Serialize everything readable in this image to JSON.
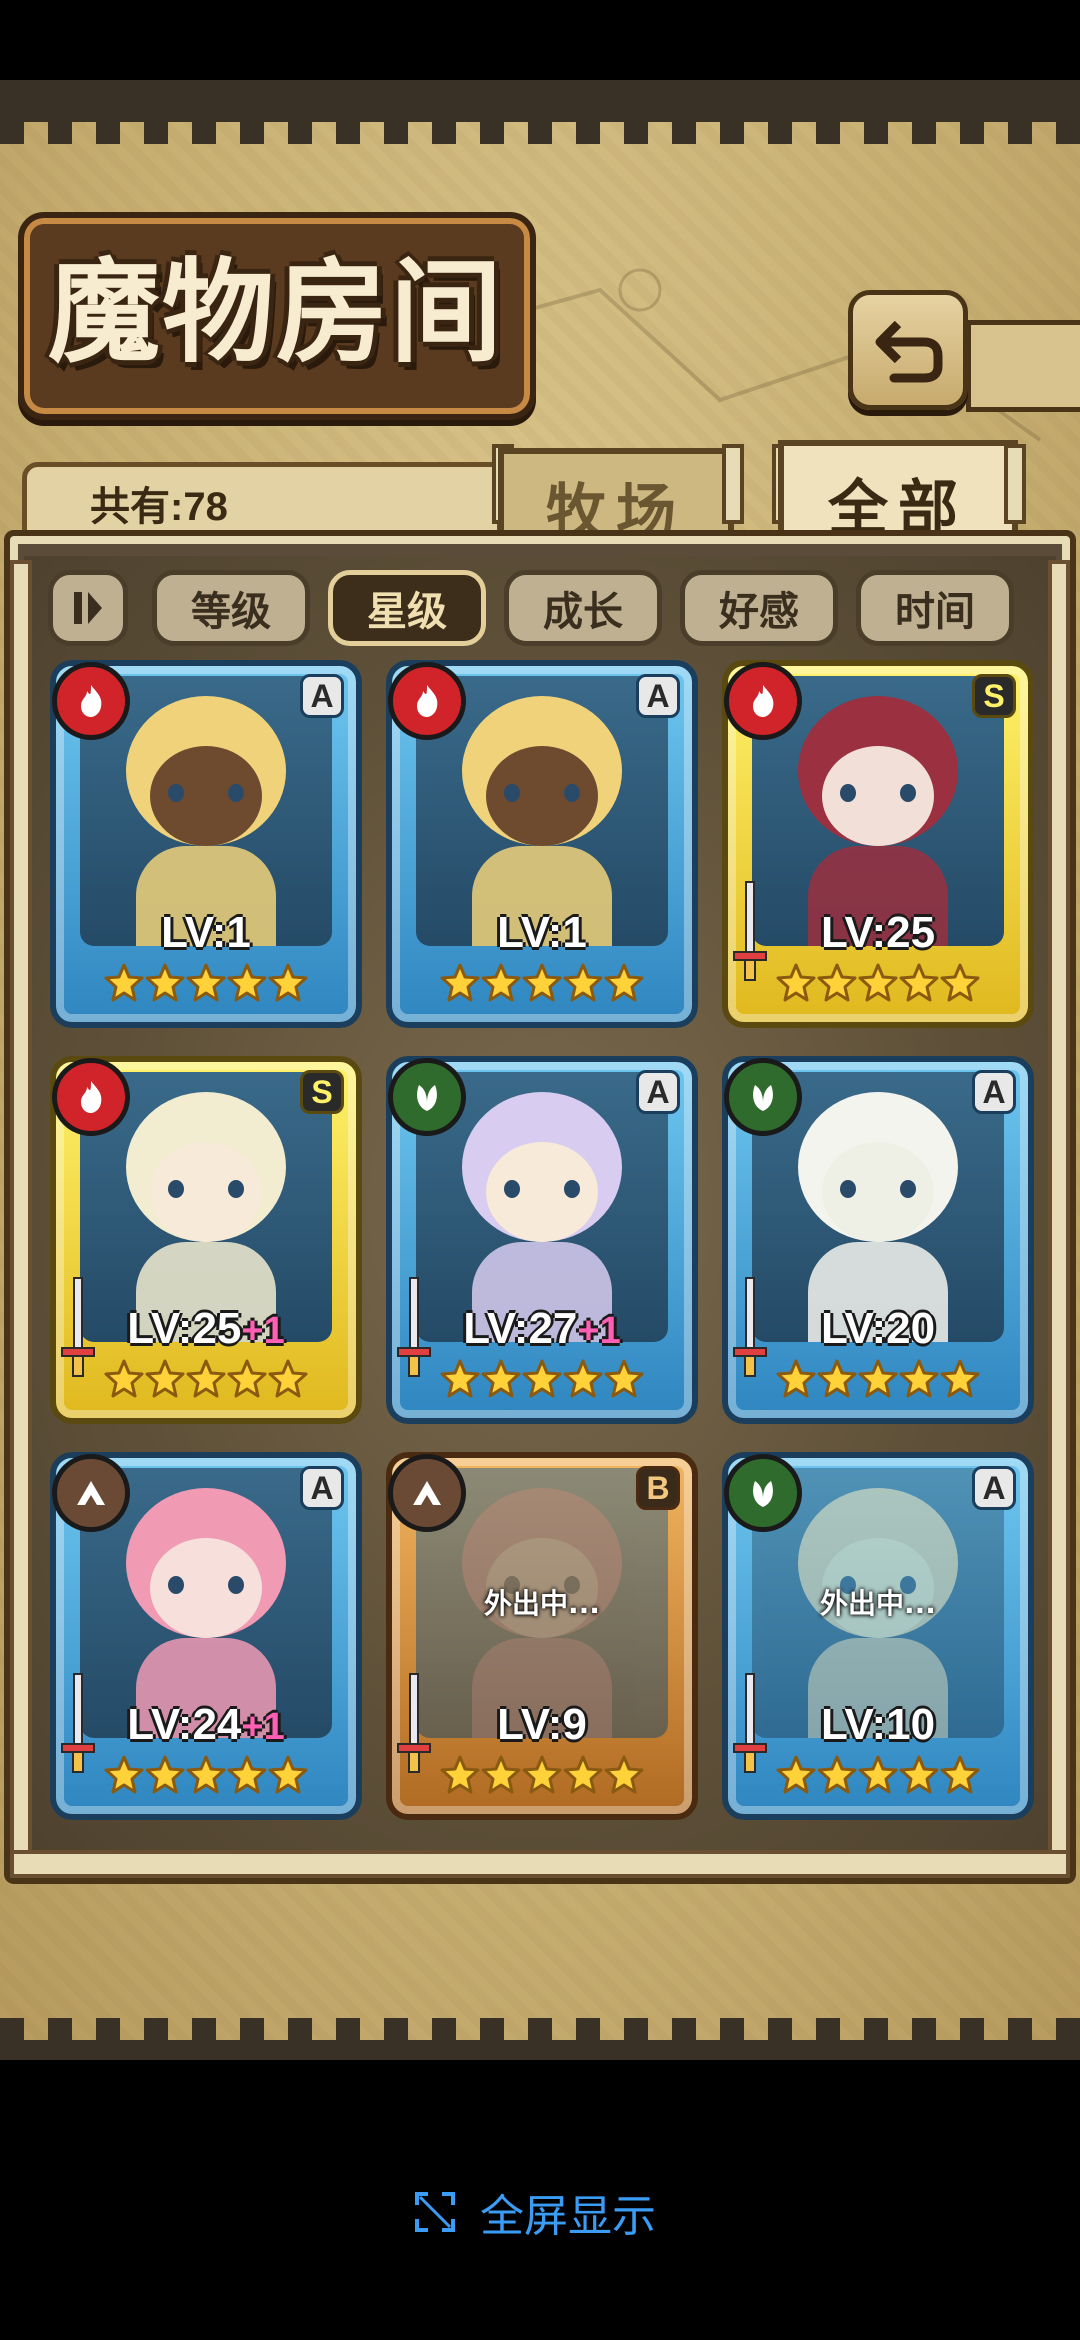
{
  "app": {
    "title": "魔物房间"
  },
  "header": {
    "count_text": "共有:78"
  },
  "tabs": [
    {
      "label": "牧场",
      "active": false
    },
    {
      "label": "全部",
      "active": true
    }
  ],
  "sort_buttons": [
    {
      "label": "等级",
      "active": false
    },
    {
      "label": "星级",
      "active": true
    },
    {
      "label": "成长",
      "active": false
    },
    {
      "label": "好感",
      "active": false
    },
    {
      "label": "时间",
      "active": false
    }
  ],
  "cards": [
    {
      "level": "LV:1",
      "plus": "",
      "rank": "A",
      "element": "fire",
      "stars": 5,
      "frame": "blue",
      "away": "",
      "sword": false
    },
    {
      "level": "LV:1",
      "plus": "",
      "rank": "A",
      "element": "fire",
      "stars": 5,
      "frame": "blue",
      "away": "",
      "sword": false
    },
    {
      "level": "LV:25",
      "plus": "",
      "rank": "S",
      "element": "fire",
      "stars": 5,
      "frame": "gold",
      "away": "",
      "sword": true
    },
    {
      "level": "LV:25",
      "plus": "+1",
      "rank": "S",
      "element": "fire",
      "stars": 5,
      "frame": "gold",
      "away": "",
      "sword": true
    },
    {
      "level": "LV:27",
      "plus": "+1",
      "rank": "A",
      "element": "leaf",
      "stars": 5,
      "frame": "blue",
      "away": "",
      "sword": true
    },
    {
      "level": "LV:20",
      "plus": "",
      "rank": "A",
      "element": "leaf",
      "stars": 5,
      "frame": "blue",
      "away": "",
      "sword": true
    },
    {
      "level": "LV:24",
      "plus": "+1",
      "rank": "A",
      "element": "earth",
      "stars": 5,
      "frame": "blue",
      "away": "",
      "sword": true
    },
    {
      "level": "LV:9",
      "plus": "",
      "rank": "B",
      "element": "earth",
      "stars": 5,
      "frame": "bronze",
      "away": "外出中...",
      "sword": true
    },
    {
      "level": "LV:10",
      "plus": "",
      "rank": "A",
      "element": "leaf",
      "stars": 5,
      "frame": "blue",
      "away": "外出中...",
      "sword": true
    }
  ],
  "footer": {
    "fullscreen_label": "全屏显示"
  },
  "colors": {
    "frame_blue": "#4fa8d8",
    "frame_gold": "#f2d23a",
    "frame_bronze": "#d08a3a",
    "fire": "#d0242a",
    "leaf": "#2e6b2c",
    "earth": "#6a4a34",
    "accent_link": "#3a9cf5"
  }
}
